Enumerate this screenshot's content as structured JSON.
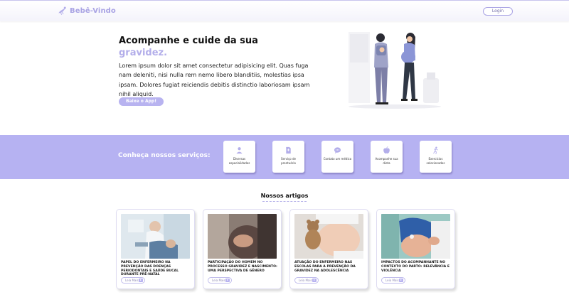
{
  "header": {
    "logo_text": "Bebê-Vindo",
    "login_label": "Login"
  },
  "hero": {
    "title": "Acompanhe e cuide da sua",
    "title_highlight": "gravidez.",
    "text": "Lorem ipsum dolor sit amet consectetur adipisicing elit. Quas fuga nam deleniti, nisi nulla rem nemo libero blanditiis, molestias ipsa ipsam. Dolores fugiat reiciendis debitis distinctio laboriosam ipsam nihil aliquid.",
    "app_button": "Baixe o App!"
  },
  "services": {
    "title": "Conheça nossos serviços:",
    "items": [
      {
        "label": "Diversas especialidades",
        "icon": "doctor-icon"
      },
      {
        "label": "Serviço de prontuário",
        "icon": "document-icon"
      },
      {
        "label": "Contato um médico",
        "icon": "chat-icon"
      },
      {
        "label": "Acompanhe sua dieta",
        "icon": "apple-icon"
      },
      {
        "label": "Exercícios selecionados",
        "icon": "exercise-icon"
      }
    ]
  },
  "articles": {
    "title": "Nossos artigos",
    "read_more": "Leia Mais",
    "items": [
      {
        "title": "Papel do enfermeiro na prevenção das doenças periodontais e saúde bucal durante pré-natal"
      },
      {
        "title": "Participação do homem no processo gravidez e nascimento: uma perspectiva de gênero"
      },
      {
        "title": "Atuação do enfermeiro nas escolas para a prevenção da gravidez na adolescência"
      },
      {
        "title": "Impactos do acompanhante no contexto do parto: relevância e violência"
      }
    ]
  },
  "colors": {
    "accent": "#b6b2f2",
    "brand": "#a9a3e4"
  }
}
